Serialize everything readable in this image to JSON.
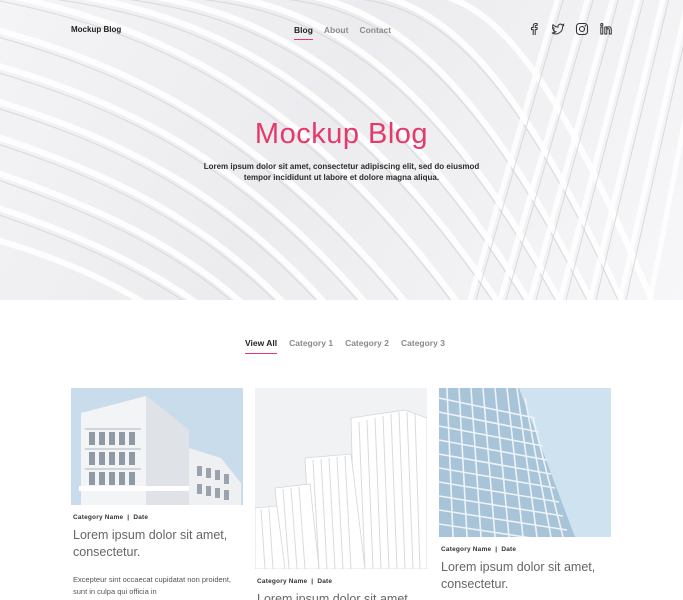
{
  "nav": {
    "brand": "Mockup Blog",
    "links": [
      {
        "label": "Blog",
        "active": true
      },
      {
        "label": "About",
        "active": false
      },
      {
        "label": "Contact",
        "active": false
      }
    ],
    "social_icons": [
      "facebook-icon",
      "twitter-icon",
      "instagram-icon",
      "linkedin-icon"
    ]
  },
  "hero": {
    "title": "Mockup Blog",
    "subtitle": "Lorem ipsum dolor sit amet, consectetur adipiscing elit, sed do eiusmod tempor incididunt ut labore et dolore magna aliqua."
  },
  "filters": [
    {
      "label": "View All",
      "active": true
    },
    {
      "label": "Category 1",
      "active": false
    },
    {
      "label": "Category 2",
      "active": false
    },
    {
      "label": "Category 3",
      "active": false
    }
  ],
  "posts": [
    {
      "meta": "Category Name  |  Date",
      "title": "Lorem ipsum dolor sit amet, consectetur.",
      "excerpt": "Excepteur sint occaecat cupidatat non proident, sunt in culpa qui officia in"
    },
    {
      "meta": "Category Name  |  Date",
      "title": "Lorem ipsum dolor sit amet,"
    },
    {
      "meta": "Category Name  |  Date",
      "title": "Lorem ipsum dolor sit amet, consectetur."
    }
  ],
  "colors": {
    "accent": "#e5396b",
    "text_dark": "#222222",
    "text_muted": "#8a8a8a"
  }
}
